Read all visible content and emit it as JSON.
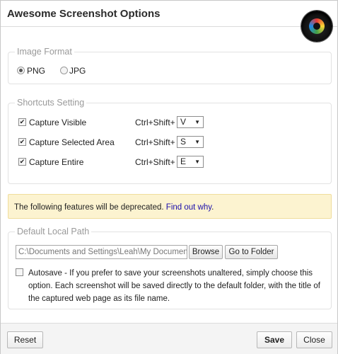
{
  "dialog": {
    "title": "Awesome Screenshot Options"
  },
  "image_format": {
    "legend": "Image Format",
    "options": [
      {
        "label": "PNG",
        "selected": true
      },
      {
        "label": "JPG",
        "selected": false
      }
    ]
  },
  "shortcuts": {
    "legend": "Shortcuts Setting",
    "modifier": "Ctrl+Shift+",
    "items": [
      {
        "label": "Capture Visible",
        "checked": true,
        "key": "V"
      },
      {
        "label": "Capture Selected Area",
        "checked": true,
        "key": "S"
      },
      {
        "label": "Capture Entire",
        "checked": true,
        "key": "E"
      }
    ]
  },
  "banner": {
    "text": "The following features will be deprecated. ",
    "link": "Find out why",
    "suffix": "."
  },
  "local_path": {
    "legend": "Default Local Path",
    "path_value": "C:\\Documents and Settings\\Leah\\My Documents",
    "browse_label": "Browse",
    "goto_label": "Go to Folder",
    "autosave_checked": false,
    "autosave_text": "Autosave - If you prefer to save your screenshots unaltered, simply choose this option. Each screenshot will be saved directly to the default folder, with the title of the captured web page as its file name."
  },
  "footer": {
    "reset_label": "Reset",
    "save_label": "Save",
    "close_label": "Close"
  },
  "colors": {
    "banner_bg": "#fcf3d0",
    "link": "#1a0dab"
  },
  "icons": {
    "logo": "camera-lens-icon",
    "dropdown": "chevron-down-icon",
    "check": "checkmark-icon"
  }
}
